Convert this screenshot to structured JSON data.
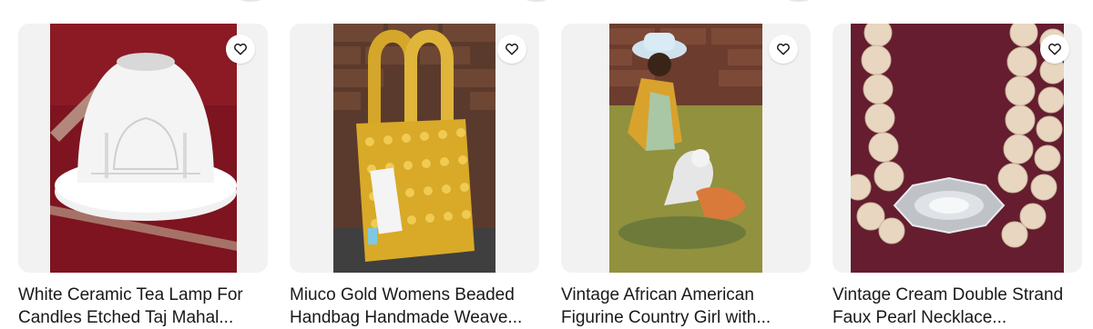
{
  "listings": [
    {
      "title": "White Ceramic Tea Lamp For Candles Etched Taj Mahal...",
      "image_icon": "taj-mahal-tea-lamp-photo",
      "watch_icon": "heart-icon"
    },
    {
      "title": "Miuco Gold Womens Beaded Handbag Handmade Weave...",
      "image_icon": "gold-beaded-handbag-photo",
      "watch_icon": "heart-icon"
    },
    {
      "title": "Vintage African American Figurine Country Girl with...",
      "image_icon": "country-girl-figurine-photo",
      "watch_icon": "heart-icon"
    },
    {
      "title": "Vintage Cream Double Strand Faux Pearl Necklace...",
      "image_icon": "pearl-necklace-photo",
      "watch_icon": "heart-icon"
    }
  ],
  "colors": {
    "card_background": "#f2f2f2",
    "title_text": "#191919",
    "watch_button_bg": "#ffffff"
  }
}
